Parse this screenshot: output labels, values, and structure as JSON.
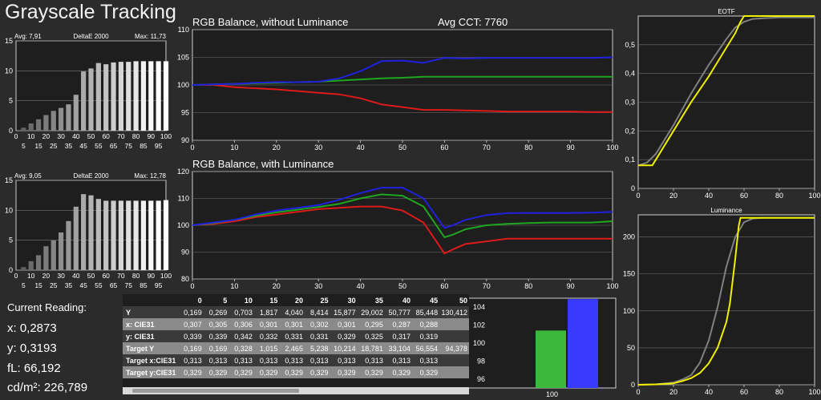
{
  "page_title": "Grayscale Tracking",
  "current_reading": {
    "heading": "Current Reading:",
    "x": "x: 0,2873",
    "y": "y: 0,3193",
    "fL": "fL: 66,192",
    "cdm2": "cd/m²: 226,789"
  },
  "chart_data": [
    {
      "id": "deltae1",
      "type": "bar",
      "title": "DeltaE 2000",
      "avg_label": "Avg: 7,91",
      "max_label": "Max: 11,73",
      "x": [
        5,
        10,
        15,
        20,
        25,
        30,
        35,
        40,
        45,
        50,
        55,
        60,
        65,
        70,
        75,
        80,
        85,
        90,
        95,
        100
      ],
      "values": [
        0.5,
        1.2,
        1.9,
        2.6,
        3.3,
        3.8,
        4.4,
        6,
        9.9,
        10.4,
        11.3,
        11.1,
        11.4,
        11.5,
        11.5,
        11.6,
        11.6,
        11.6,
        11.6,
        11.6
      ],
      "ylim": [
        0,
        15
      ],
      "yticks": [
        0,
        5,
        10,
        15
      ],
      "xticks": [
        5,
        15,
        25,
        35,
        45,
        55,
        65,
        75,
        85,
        95
      ],
      "xticks2": [
        0,
        10,
        20,
        30,
        40,
        50,
        60,
        70,
        80,
        90,
        100
      ]
    },
    {
      "id": "deltae2",
      "type": "bar",
      "title": "DeltaE 2000",
      "avg_label": "Avg: 9,05",
      "max_label": "Max: 12,78",
      "x": [
        5,
        10,
        15,
        20,
        25,
        30,
        35,
        40,
        45,
        50,
        55,
        60,
        65,
        70,
        75,
        80,
        85,
        90,
        95,
        100
      ],
      "values": [
        0.5,
        1.5,
        2.5,
        4,
        5,
        6.3,
        8.2,
        10.6,
        12.7,
        12.5,
        11.9,
        11.6,
        11.6,
        11.6,
        11.6,
        11.6,
        11.6,
        11.6,
        11.6,
        11.7
      ],
      "ylim": [
        0,
        15
      ],
      "yticks": [
        0,
        5,
        10,
        15
      ],
      "xticks": [
        5,
        15,
        25,
        35,
        45,
        55,
        65,
        75,
        85,
        95
      ],
      "xticks2": [
        0,
        10,
        20,
        30,
        40,
        50,
        60,
        70,
        80,
        90,
        100
      ]
    },
    {
      "id": "rgb1",
      "type": "line",
      "title": "RGB Balance, without Luminance",
      "subtitle": "Avg CCT: 7760",
      "xlim": [
        0,
        100
      ],
      "ylim": [
        90,
        110
      ],
      "xticks": [
        0,
        10,
        20,
        30,
        40,
        50,
        60,
        70,
        80,
        90,
        100
      ],
      "yticks": [
        90,
        95,
        100,
        105,
        110
      ],
      "series": [
        {
          "color": "#dd1a1a",
          "x": [
            0,
            5,
            10,
            15,
            20,
            25,
            30,
            35,
            40,
            45,
            50,
            55,
            60,
            65,
            70,
            75,
            80,
            85,
            90,
            95,
            100
          ],
          "y": [
            100,
            100,
            99.6,
            99.4,
            99.2,
            98.9,
            98.6,
            98.3,
            97.6,
            96.5,
            96,
            95.5,
            95.5,
            95.4,
            95.3,
            95.2,
            95.2,
            95.2,
            95.2,
            95.1,
            95.1
          ]
        },
        {
          "color": "#1fa51f",
          "x": [
            0,
            5,
            10,
            15,
            20,
            25,
            30,
            35,
            40,
            45,
            50,
            55,
            60,
            65,
            70,
            75,
            80,
            85,
            90,
            95,
            100
          ],
          "y": [
            100,
            100.1,
            100.2,
            100.3,
            100.4,
            100.5,
            100.6,
            100.8,
            101,
            101.2,
            101.3,
            101.5,
            101.5,
            101.5,
            101.5,
            101.5,
            101.5,
            101.5,
            101.5,
            101.5,
            101.5
          ]
        },
        {
          "color": "#2020dd",
          "x": [
            0,
            5,
            10,
            15,
            20,
            25,
            30,
            35,
            40,
            45,
            50,
            55,
            60,
            65,
            70,
            75,
            80,
            85,
            90,
            95,
            100
          ],
          "y": [
            100,
            100.1,
            100.2,
            100.4,
            100.5,
            100.5,
            100.6,
            101.2,
            102.5,
            104.3,
            104.4,
            104,
            104.9,
            104.8,
            104.9,
            104.9,
            104.9,
            104.9,
            104.9,
            104.9,
            105
          ]
        }
      ]
    },
    {
      "id": "rgb2",
      "type": "line",
      "title": "RGB Balance, with Luminance",
      "xlim": [
        0,
        100
      ],
      "ylim": [
        80,
        120
      ],
      "xticks": [
        0,
        10,
        20,
        30,
        40,
        50,
        60,
        70,
        80,
        90,
        100
      ],
      "yticks": [
        80,
        90,
        100,
        110,
        120
      ],
      "series": [
        {
          "color": "#dd1a1a",
          "x": [
            0,
            5,
            10,
            15,
            20,
            25,
            30,
            35,
            40,
            45,
            50,
            55,
            60,
            62,
            65,
            70,
            75,
            80,
            85,
            90,
            95,
            100
          ],
          "y": [
            100,
            100.5,
            101.5,
            103,
            104,
            105,
            106,
            106.5,
            107,
            107,
            105.5,
            101,
            89.5,
            91,
            93,
            94,
            95,
            95,
            95,
            95,
            95,
            95
          ]
        },
        {
          "color": "#1fa51f",
          "x": [
            0,
            5,
            10,
            15,
            20,
            25,
            30,
            35,
            40,
            45,
            50,
            55,
            60,
            62,
            65,
            70,
            75,
            80,
            85,
            90,
            95,
            100
          ],
          "y": [
            100,
            100.8,
            102,
            103.5,
            104.8,
            105.8,
            106.8,
            108,
            110,
            111.5,
            111,
            107,
            95.5,
            96.5,
            98.5,
            100,
            100.5,
            100.8,
            101,
            101,
            101,
            101.5
          ]
        },
        {
          "color": "#2020dd",
          "x": [
            0,
            5,
            10,
            15,
            20,
            25,
            30,
            35,
            40,
            45,
            50,
            55,
            60,
            62,
            65,
            70,
            75,
            80,
            85,
            90,
            95,
            100
          ],
          "y": [
            100,
            101,
            102,
            104,
            105.5,
            106.5,
            107.5,
            109.5,
            112,
            114,
            114,
            110,
            99,
            100,
            102,
            103.8,
            104.5,
            104.6,
            104.6,
            104.6,
            104.7,
            105
          ]
        }
      ]
    },
    {
      "id": "eotf",
      "type": "line",
      "title": "EOTF",
      "xlim": [
        0,
        100
      ],
      "ylim": [
        0,
        0.6
      ],
      "xticks": [
        0,
        20,
        40,
        60,
        80,
        100
      ],
      "yticks": [
        0,
        0.1,
        0.2,
        0.3,
        0.4,
        0.5
      ],
      "ytick_labels": [
        "0",
        "0,1",
        "0,2",
        "0,3",
        "0,4",
        "0,5"
      ],
      "series": [
        {
          "color": "#808080",
          "x": [
            0,
            5,
            10,
            20,
            30,
            40,
            50,
            55,
            60,
            65,
            70,
            80,
            90,
            100
          ],
          "y": [
            0.08,
            0.09,
            0.12,
            0.22,
            0.33,
            0.43,
            0.52,
            0.56,
            0.58,
            0.59,
            0.592,
            0.595,
            0.595,
            0.595
          ]
        },
        {
          "color": "#f0f000",
          "x": [
            0,
            4,
            8,
            10,
            20,
            30,
            40,
            50,
            55,
            58,
            60,
            65,
            70,
            80,
            90,
            100
          ],
          "y": [
            0.08,
            0.08,
            0.08,
            0.1,
            0.2,
            0.3,
            0.39,
            0.49,
            0.54,
            0.58,
            0.6,
            0.6,
            0.6,
            0.6,
            0.6,
            0.6
          ]
        }
      ]
    },
    {
      "id": "luminance",
      "type": "line",
      "title": "Luminance",
      "xlim": [
        0,
        100
      ],
      "ylim": [
        0,
        230
      ],
      "xticks": [
        0,
        20,
        40,
        60,
        80,
        100
      ],
      "yticks": [
        0,
        50,
        100,
        150,
        200
      ],
      "series": [
        {
          "color": "#808080",
          "x": [
            0,
            10,
            20,
            25,
            30,
            35,
            40,
            45,
            50,
            55,
            60,
            65,
            70,
            80,
            90,
            100
          ],
          "y": [
            0,
            0.5,
            3,
            7,
            13,
            30,
            60,
            105,
            160,
            200,
            220,
            225,
            226,
            226,
            226,
            226
          ]
        },
        {
          "color": "#f0f000",
          "x": [
            0,
            10,
            20,
            25,
            30,
            35,
            40,
            45,
            50,
            52,
            55,
            57,
            58,
            60,
            70,
            80,
            90,
            100
          ],
          "y": [
            0,
            0.5,
            2,
            5,
            9,
            16,
            29,
            50,
            85,
            110,
            170,
            215,
            226,
            226,
            226,
            226,
            226,
            226
          ]
        }
      ]
    },
    {
      "id": "rgbbars",
      "type": "bar",
      "categories": [
        "100"
      ],
      "ylim": [
        95,
        105
      ],
      "yticks": [
        96,
        98,
        100,
        102,
        104
      ],
      "series": [
        {
          "color": "#3cb83c",
          "values": [
            101.4
          ]
        },
        {
          "color": "#3a3aff",
          "values": [
            104.9
          ]
        }
      ]
    }
  ],
  "table": {
    "headers": [
      "0",
      "5",
      "10",
      "15",
      "20",
      "25",
      "30",
      "35",
      "40",
      "45",
      "50"
    ],
    "rows": [
      {
        "label": "Y",
        "values": [
          "0,169",
          "0,269",
          "0,703",
          "1,817",
          "4,040",
          "8,414",
          "15,877",
          "29,002",
          "50,777",
          "85,448",
          "130,412"
        ]
      },
      {
        "label": "x: CIE31",
        "values": [
          "0,307",
          "0,305",
          "0,306",
          "0,301",
          "0,301",
          "0,302",
          "0,301",
          "0,295",
          "0,287",
          "0,288",
          ""
        ]
      },
      {
        "label": "y: CIE31",
        "values": [
          "0,339",
          "0,339",
          "0,342",
          "0,332",
          "0,331",
          "0,331",
          "0,329",
          "0,325",
          "0,317",
          "0,319",
          ""
        ]
      },
      {
        "label": "Target Y",
        "values": [
          "0,169",
          "0,169",
          "0,328",
          "1,015",
          "2,465",
          "5,238",
          "10,214",
          "18,781",
          "33,104",
          "56,554",
          "94,378"
        ]
      },
      {
        "label": "Target x:CIE31",
        "values": [
          "0,313",
          "0,313",
          "0,313",
          "0,313",
          "0,313",
          "0,313",
          "0,313",
          "0,313",
          "0,313",
          "0,313",
          ""
        ]
      },
      {
        "label": "Target y:CIE31",
        "values": [
          "0,329",
          "0,329",
          "0,329",
          "0,329",
          "0,329",
          "0,329",
          "0,329",
          "0,329",
          "0,329",
          "0,329",
          ""
        ]
      }
    ]
  }
}
